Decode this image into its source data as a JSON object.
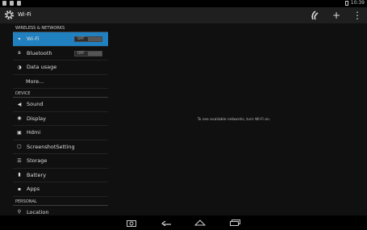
{
  "status_bar": {
    "time": "10:39",
    "left_icons": [
      "usb-icon",
      "image-icon",
      "sd-card-icon"
    ]
  },
  "action_bar": {
    "title": "Wi-Fi",
    "actions": [
      {
        "icon": "wps-icon"
      },
      {
        "icon": "plus-icon",
        "glyph": "+"
      },
      {
        "icon": "overflow-menu-icon",
        "glyph": "⋮"
      }
    ]
  },
  "sections": [
    {
      "header": "WIRELESS & NETWORKS",
      "items": [
        {
          "label": "Wi-Fi",
          "icon": "wifi-icon",
          "glyph": "▾",
          "toggle": "OFF",
          "active": true
        },
        {
          "label": "Bluetooth",
          "icon": "bluetooth-icon",
          "glyph": "ʙ",
          "toggle": "OFF"
        },
        {
          "label": "Data usage",
          "icon": "data-usage-icon",
          "glyph": "◑"
        },
        {
          "label": "More...",
          "more": true
        }
      ]
    },
    {
      "header": "DEVICE",
      "items": [
        {
          "label": "Sound",
          "icon": "sound-icon",
          "glyph": "◀"
        },
        {
          "label": "Display",
          "icon": "display-icon",
          "glyph": "◉"
        },
        {
          "label": "Hdmi",
          "icon": "hdmi-icon",
          "glyph": "▣"
        },
        {
          "label": "ScreenshotSetting",
          "icon": "screenshot-icon",
          "glyph": "▢"
        },
        {
          "label": "Storage",
          "icon": "storage-icon",
          "glyph": "☰"
        },
        {
          "label": "Battery",
          "icon": "battery-icon",
          "glyph": "▮"
        },
        {
          "label": "Apps",
          "icon": "apps-icon",
          "glyph": "▪"
        }
      ]
    },
    {
      "header": "PERSONAL",
      "items": [
        {
          "label": "Location",
          "icon": "location-icon",
          "glyph": "⚲"
        }
      ]
    }
  ],
  "content": {
    "message": "To see available networks, turn Wi-Fi on."
  },
  "nav_bar": [
    "screenshot-icon",
    "back-icon",
    "home-icon",
    "recent-apps-icon"
  ],
  "colors": {
    "active": "#2080c0",
    "background": "#101010",
    "action_bar": "#1f1f1f"
  }
}
